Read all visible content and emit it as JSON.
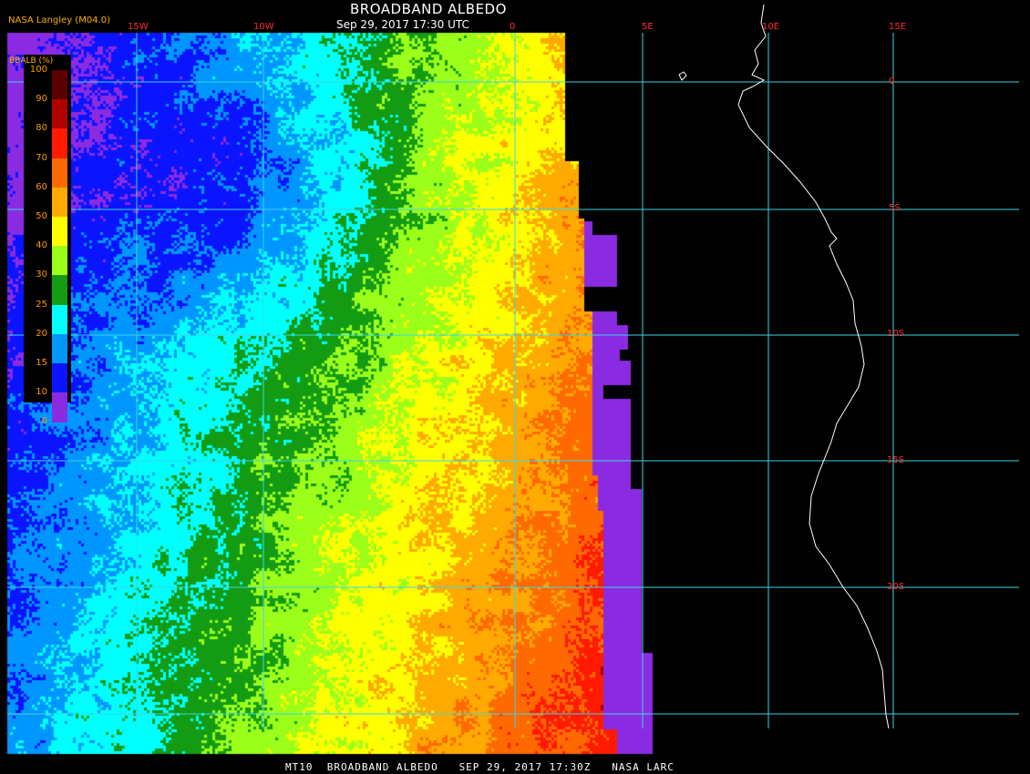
{
  "header": {
    "title": "BROADBAND ALBEDO",
    "subtitle": "Sep 29, 2017 17:30 UTC",
    "credit": "NASA Langley (M04.0)"
  },
  "footer": {
    "caption": "MT10  BROADBAND ALBEDO   SEP 29, 2017 17:30Z   NASA LARC"
  },
  "map": {
    "longitude_labels": [
      "15W",
      "10W",
      "0",
      "5E",
      "10E",
      "15E"
    ],
    "latitude_labels": [
      "0",
      "5S",
      "10S",
      "15S",
      "20S"
    ],
    "gridline_color": "#3ad6e6",
    "coastline_color": "#ffffff",
    "label_color": "#ff2a2a"
  },
  "legend": {
    "unit_label": "BBALB (%)",
    "ticks": [
      "100",
      "90",
      "80",
      "70",
      "60",
      "50",
      "40",
      "30",
      "25",
      "20",
      "15",
      "10",
      "0"
    ],
    "colors": [
      "#5a0000",
      "#b00000",
      "#ff1a00",
      "#ff6a00",
      "#ffaa00",
      "#ffff00",
      "#9cff1a",
      "#139c13",
      "#00ffff",
      "#0096ff",
      "#0a14ff",
      "#8a2be2"
    ]
  }
}
